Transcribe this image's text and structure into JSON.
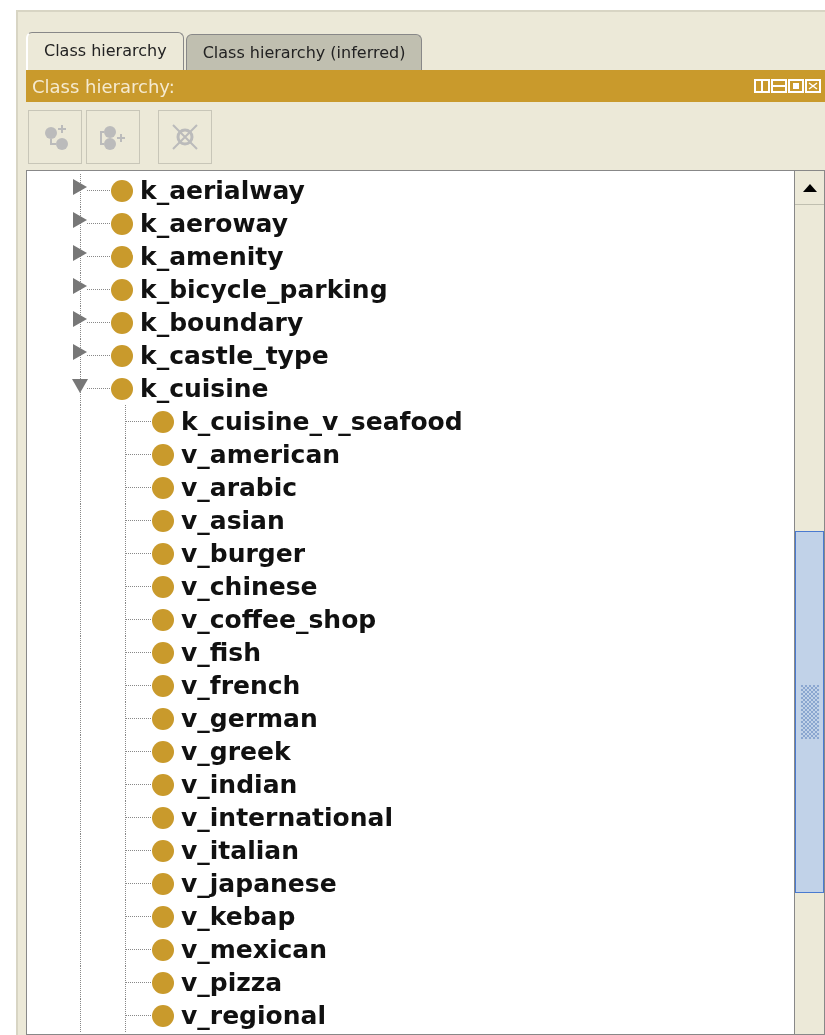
{
  "tabs": [
    {
      "label": "Class hierarchy",
      "selected": true
    },
    {
      "label": "Class hierarchy (inferred)",
      "selected": false
    }
  ],
  "panel": {
    "title": "Class hierarchy:"
  },
  "toolbar": [
    {
      "kind": "add-subclass",
      "disabled": true
    },
    {
      "kind": "add-sibling",
      "disabled": true
    },
    {
      "kind": "delete",
      "disabled": true
    }
  ],
  "tree": [
    {
      "label": "k_aerialway",
      "expanded": false
    },
    {
      "label": "k_aeroway",
      "expanded": false
    },
    {
      "label": "k_amenity",
      "expanded": false
    },
    {
      "label": "k_bicycle_parking",
      "expanded": false
    },
    {
      "label": "k_boundary",
      "expanded": false
    },
    {
      "label": "k_castle_type",
      "expanded": false
    },
    {
      "label": "k_cuisine",
      "expanded": true,
      "children": [
        {
          "label": "k_cuisine_v_seafood"
        },
        {
          "label": "v_american"
        },
        {
          "label": "v_arabic"
        },
        {
          "label": "v_asian"
        },
        {
          "label": "v_burger"
        },
        {
          "label": "v_chinese"
        },
        {
          "label": "v_coffee_shop"
        },
        {
          "label": "v_fish"
        },
        {
          "label": "v_french"
        },
        {
          "label": "v_german"
        },
        {
          "label": "v_greek"
        },
        {
          "label": "v_indian"
        },
        {
          "label": "v_international"
        },
        {
          "label": "v_italian"
        },
        {
          "label": "v_japanese"
        },
        {
          "label": "v_kebap"
        },
        {
          "label": "v_mexican"
        },
        {
          "label": "v_pizza"
        },
        {
          "label": "v_regional"
        }
      ]
    }
  ]
}
